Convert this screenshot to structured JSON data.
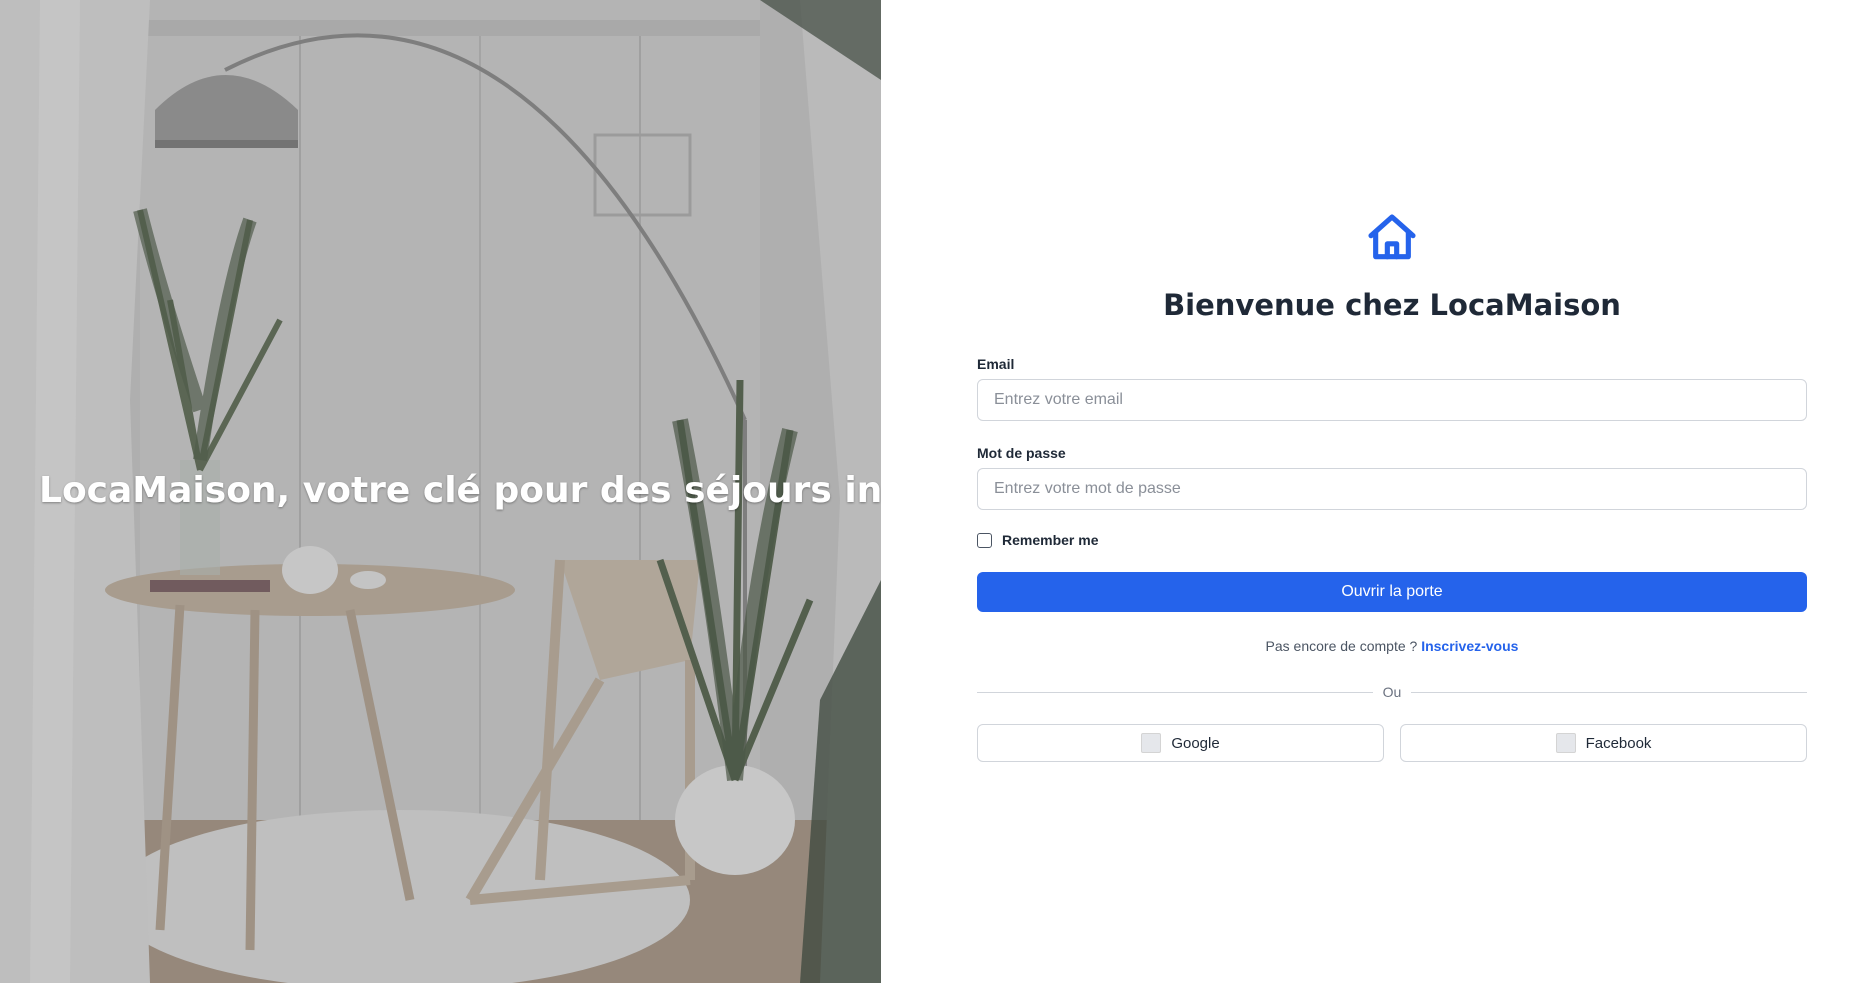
{
  "hero": {
    "tagline": "LocaMaison, votre clé pour des séjours inoubli"
  },
  "form": {
    "logo_icon": "house-icon",
    "title": "Bienvenue chez LocaMaison",
    "email_label": "Email",
    "email_placeholder": "Entrez votre email",
    "email_value": "",
    "password_label": "Mot de passe",
    "password_placeholder": "Entrez votre mot de passe",
    "password_value": "",
    "remember_label": "Remember me",
    "remember_checked": false,
    "submit_label": "Ouvrir la porte",
    "signup_prompt": "Pas encore de compte ? ",
    "signup_link": "Inscrivez-vous",
    "divider_label": "Ou",
    "social": {
      "google_label": "Google",
      "facebook_label": "Facebook"
    }
  },
  "colors": {
    "accent": "#2563eb",
    "heading": "#1f2937",
    "border": "#d1d5db"
  }
}
